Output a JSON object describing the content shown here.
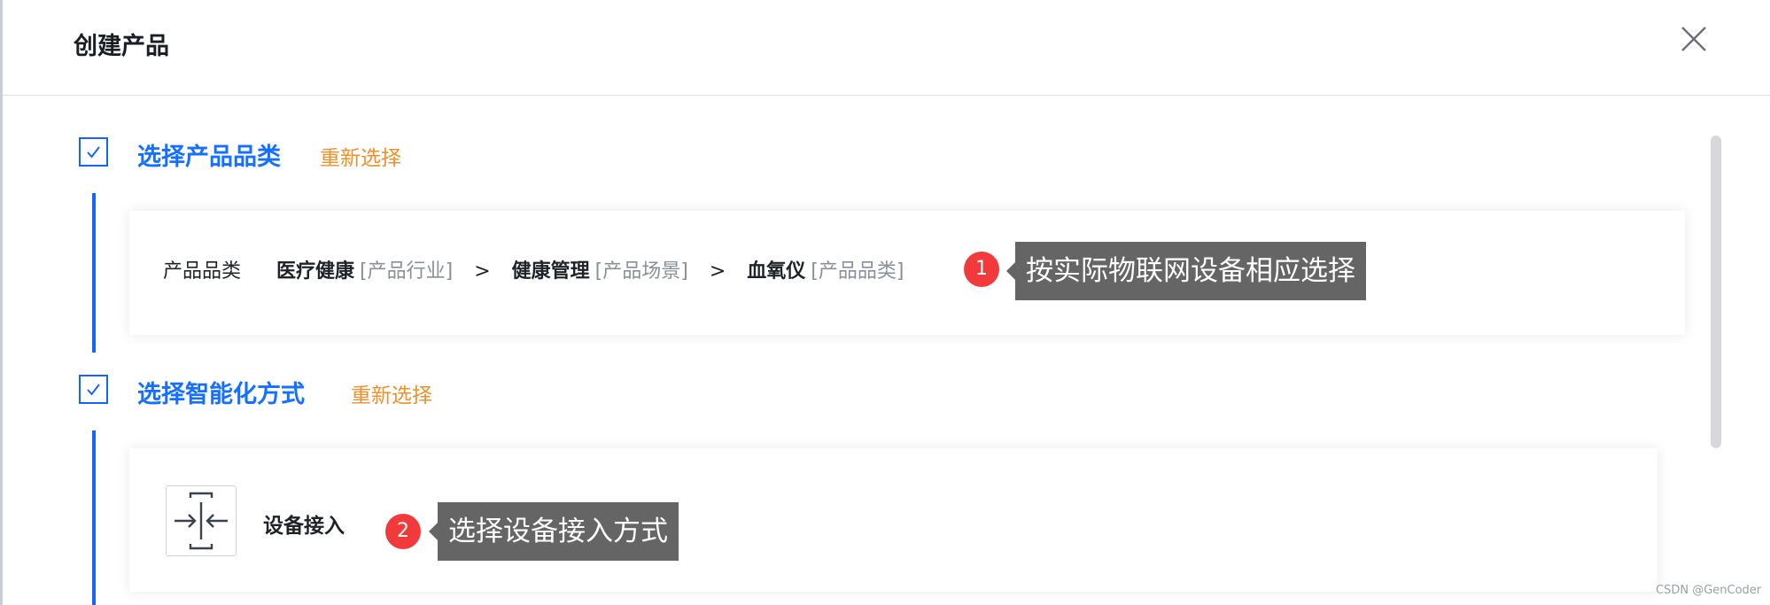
{
  "modal": {
    "title": "创建产品"
  },
  "steps": [
    {
      "title": "选择产品品类",
      "reselect_label": "重新选择"
    },
    {
      "title": "选择智能化方式",
      "reselect_label": "重新选择"
    }
  ],
  "category": {
    "label": "产品品类",
    "path": [
      {
        "name": "医疗健康",
        "meta": "[产品行业]"
      },
      {
        "name": "健康管理",
        "meta": "[产品场景]"
      },
      {
        "name": "血氧仪",
        "meta": "[产品品类]"
      }
    ],
    "separator": ">"
  },
  "access": {
    "label": "设备接入"
  },
  "annotations": [
    {
      "number": "1",
      "text": "按实际物联网设备相应选择"
    },
    {
      "number": "2",
      "text": "选择设备接入方式"
    }
  ],
  "icons": [
    "close-icon",
    "check-icon",
    "device-access-icon"
  ],
  "colors": {
    "primary": "#1664ff",
    "reselect": "#f0902a",
    "badge": "#f23a3c",
    "tooltip_bg": "#656565"
  },
  "watermark": "CSDN @GenCoder"
}
